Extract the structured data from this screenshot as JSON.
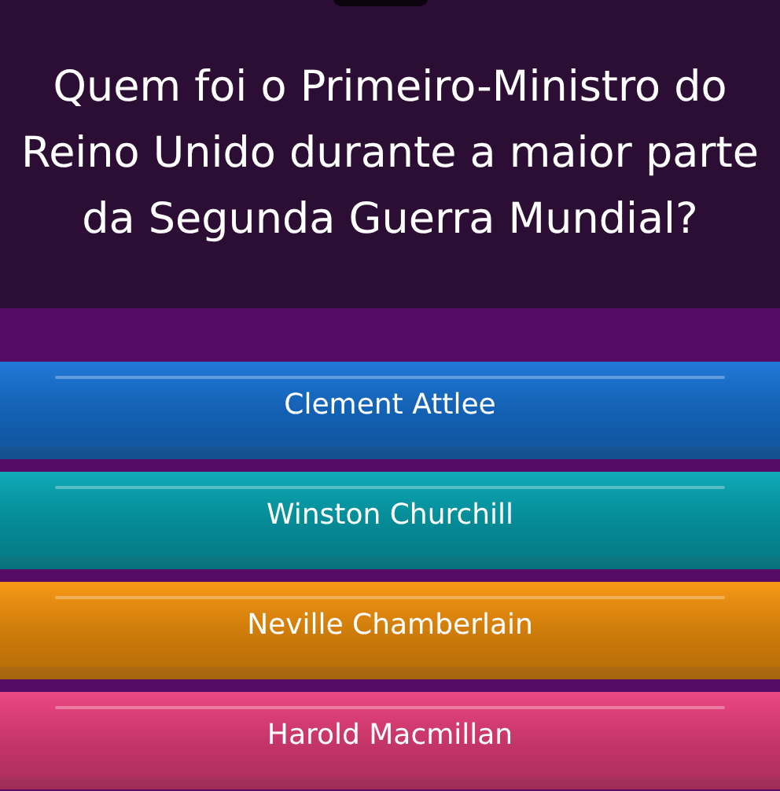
{
  "question": "Quem foi o Primeiro-Ministro do Reino Unido durante a maior parte da Segunda Guerra Mundial?",
  "answers": [
    {
      "label": "Clement Attlee",
      "color": "#1673d6"
    },
    {
      "label": "Winston Churchill",
      "color": "#05a6b4"
    },
    {
      "label": "Neville Chamberlain",
      "color": "#f7940c"
    },
    {
      "label": "Harold Macmillan",
      "color": "#ec3f7c"
    }
  ]
}
